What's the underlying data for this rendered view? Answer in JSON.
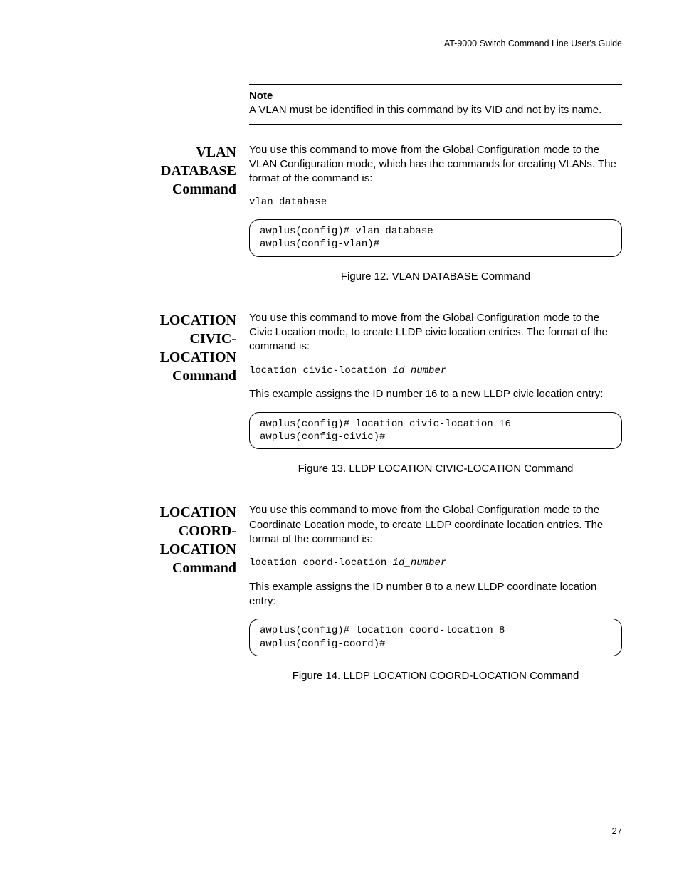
{
  "header": {
    "running": "AT-9000 Switch Command Line User's Guide"
  },
  "note": {
    "label": "Note",
    "text": "A VLAN must be identified in this command by its VID and not by its name."
  },
  "sections": [
    {
      "sidehead": {
        "l1": "VLAN",
        "l2": "DATABASE",
        "l3": "Command"
      },
      "intro": "You use this command to move from the Global Configuration mode to the VLAN Configuration mode, which has the commands for creating VLANs. The format of the command is:",
      "syntax": "vlan database",
      "example_intro": "",
      "code": "awplus(config)# vlan database\nawplus(config-vlan)#",
      "caption": "Figure 12. VLAN DATABASE Command"
    },
    {
      "sidehead": {
        "l1": "LOCATION",
        "l2": "CIVIC-",
        "l3": "LOCATION",
        "l4": "Command"
      },
      "intro": "You use this command to move from the Global Configuration mode to the Civic Location mode, to create LLDP civic location entries. The format of the command is:",
      "syntax_prefix": "location civic-location ",
      "syntax_param": "id_number",
      "example_intro": "This example assigns the ID number 16 to a new LLDP civic location entry:",
      "code": "awplus(config)# location civic-location 16\nawplus(config-civic)#",
      "caption": "Figure 13. LLDP LOCATION CIVIC-LOCATION Command"
    },
    {
      "sidehead": {
        "l1": "LOCATION",
        "l2": "COORD-",
        "l3": "LOCATION",
        "l4": "Command"
      },
      "intro": "You use this command to move from the Global Configuration mode to the Coordinate Location mode, to create LLDP coordinate location entries. The format of the command is:",
      "syntax_prefix": "location coord-location ",
      "syntax_param": "id_number",
      "example_intro": "This example assigns the ID number 8 to a new LLDP coordinate location entry:",
      "code": "awplus(config)# location coord-location 8\nawplus(config-coord)#",
      "caption": "Figure 14. LLDP LOCATION COORD-LOCATION Command"
    }
  ],
  "page_number": "27"
}
